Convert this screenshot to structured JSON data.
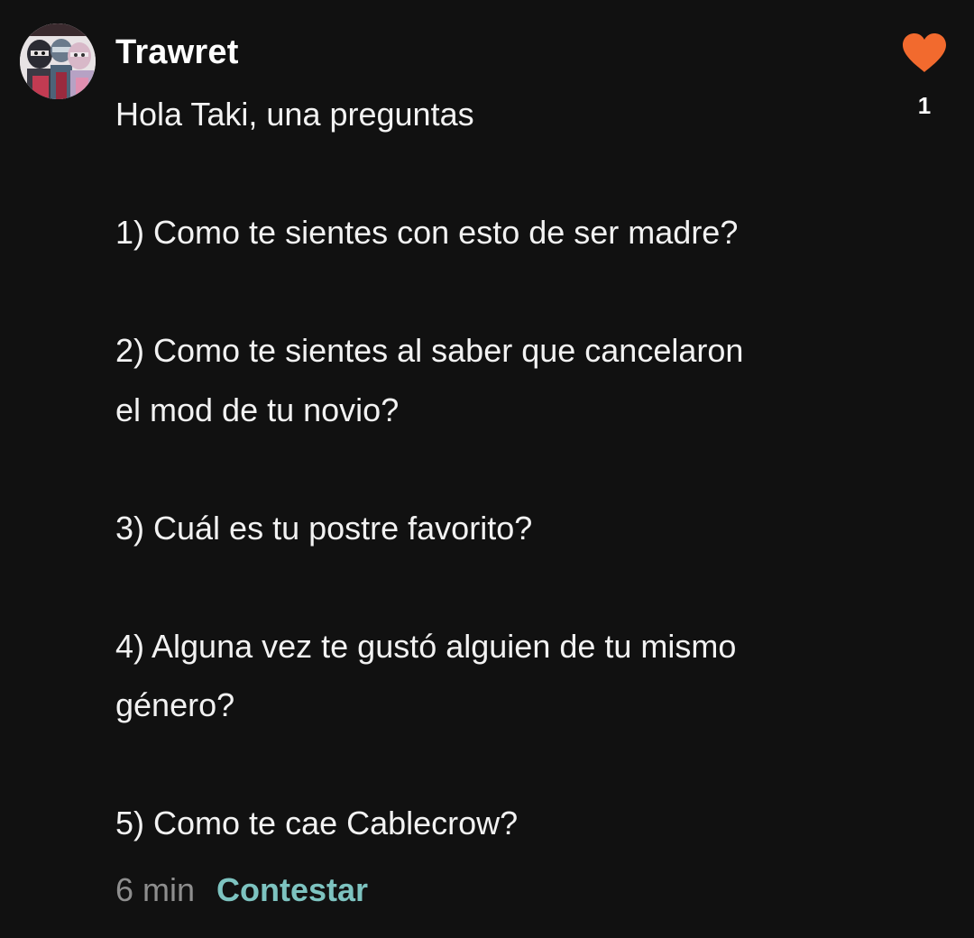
{
  "comment": {
    "username": "Trawret",
    "lines": [
      "Hola Taki, una preguntas",
      "",
      "1) Como te sientes con esto de ser madre?",
      "",
      "2) Como te sientes al saber que cancelaron",
      "el mod de tu novio?",
      "",
      "3) Cuál es tu postre favorito?",
      "",
      "4) Alguna vez te gustó alguien de tu mismo",
      "género?",
      "",
      "5) Como te cae Cablecrow?"
    ],
    "timestamp": "6 min",
    "reply_label": "Contestar",
    "like_count": "1",
    "icons": {
      "like": "heart-icon",
      "avatar": "user-avatar"
    },
    "colors": {
      "background": "#111111",
      "heart": "#f26a2e",
      "reply": "#7dc3c0",
      "timestamp": "#8e8e8e"
    }
  }
}
